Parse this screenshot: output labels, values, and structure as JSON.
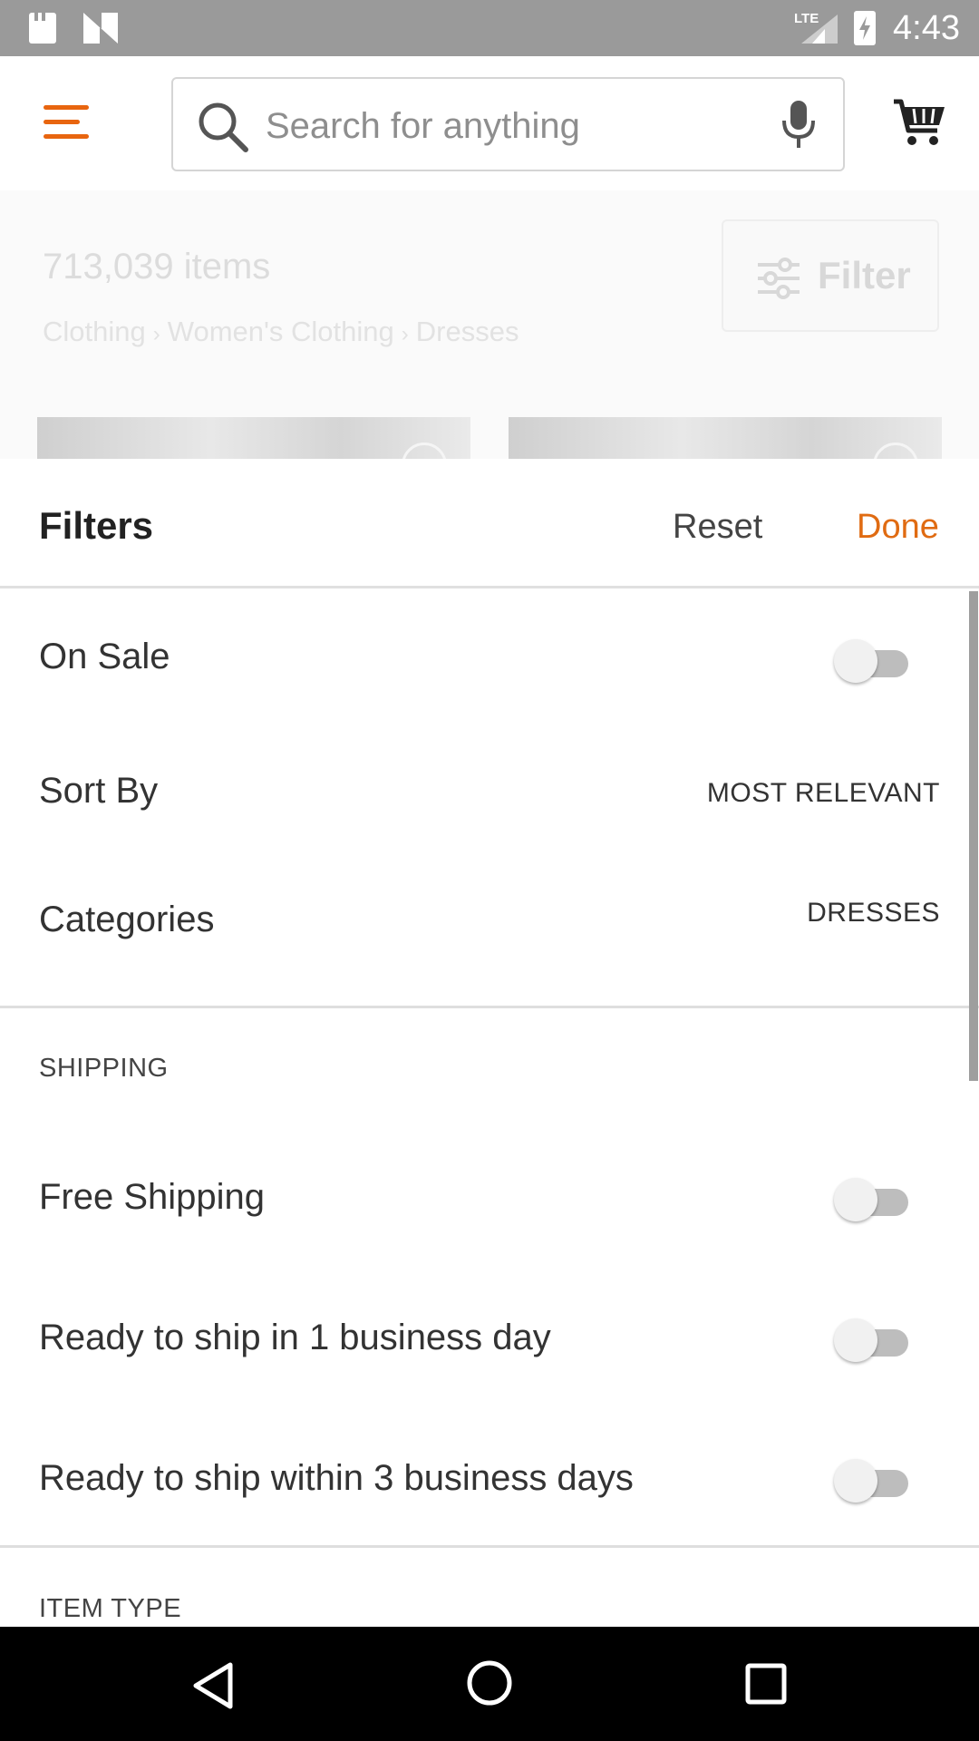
{
  "status_bar": {
    "network": "LTE",
    "time": "4:43"
  },
  "header": {
    "search_placeholder": "Search for anything"
  },
  "results": {
    "count": "713,039 items",
    "breadcrumb": [
      "Clothing",
      "Women's Clothing",
      "Dresses"
    ],
    "filter_label": "Filter"
  },
  "filters": {
    "title": "Filters",
    "reset_label": "Reset",
    "done_label": "Done",
    "on_sale": {
      "label": "On Sale",
      "enabled": false
    },
    "sort_by": {
      "label": "Sort By",
      "value": "MOST RELEVANT"
    },
    "categories": {
      "label": "Categories",
      "value": "DRESSES"
    },
    "shipping": {
      "heading": "SHIPPING",
      "options": [
        {
          "label": "Free Shipping",
          "enabled": false
        },
        {
          "label": "Ready to ship in 1 business day",
          "enabled": false
        },
        {
          "label": "Ready to ship within 3 business days",
          "enabled": false
        }
      ]
    },
    "item_type": {
      "heading": "ITEM TYPE"
    }
  },
  "colors": {
    "accent": "#e06b12",
    "status_bar": "#9a9a9a"
  }
}
